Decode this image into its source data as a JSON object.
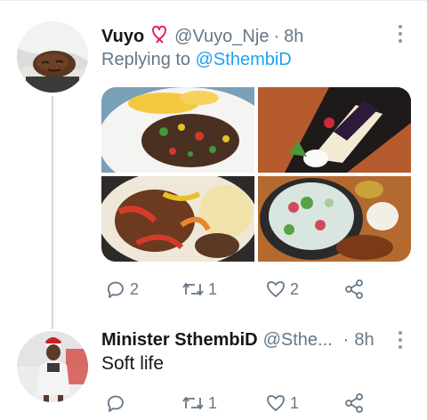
{
  "tweet1": {
    "name": "Vuyo",
    "handle": "@Vuyo_Nje",
    "separator": "·",
    "time": "8h",
    "replying_prefix": "Replying to",
    "replying_to": "@SthembiD",
    "emoji_icon": "heart-ribbon-emoji",
    "actions": {
      "reply_count": "2",
      "retweet_count": "1",
      "like_count": "2",
      "share_count": ""
    }
  },
  "tweet2": {
    "name": "Minister SthembiD",
    "handle": "@Sthe...",
    "separator": "·",
    "time": "8h",
    "text": "Soft life",
    "actions": {
      "reply_count": "",
      "retweet_count": "1",
      "like_count": "1",
      "share_count": ""
    }
  },
  "colors": {
    "accent": "#1da1f2",
    "secondary_text": "#657786",
    "primary_text": "#14171a",
    "thread_line": "#cfd9de"
  }
}
